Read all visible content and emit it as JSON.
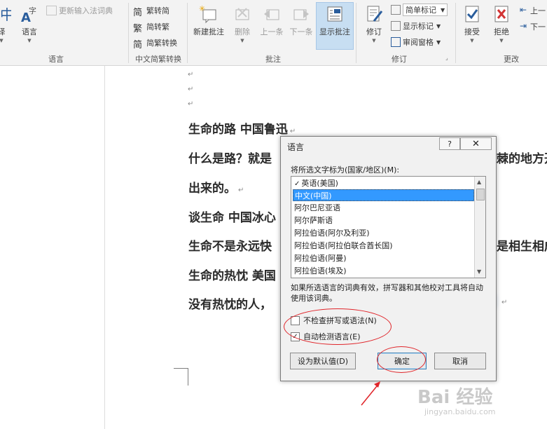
{
  "ribbon": {
    "groups": {
      "language": "语言",
      "chinese_conversion": "中文简繁转换",
      "comments": "批注",
      "tracking": "修订",
      "changes": "更改"
    },
    "translate_label": "译",
    "language_label": "语言",
    "update_ime_dict": "更新输入法词典",
    "trad_to_simp": "繁转简",
    "simp_to_trad": "简转繁",
    "simp_trad_convert": "简繁转换",
    "new_comment": "新建批注",
    "delete": "删除",
    "previous": "上一条",
    "next": "下一条",
    "show_comments": "显示批注",
    "track_changes": "修订",
    "simple_markup": "简单标记",
    "show_markup": "显示标记",
    "reviewing_pane": "审阅窗格",
    "accept": "接受",
    "reject": "拒绝",
    "prev_change": "上一",
    "next_change": "下一"
  },
  "document": {
    "lines": [
      "生命的路  中国鲁迅",
      "什么是路？就是",
      "出来的。",
      "谈生命  中国冰心",
      "生命不是永远快",
      "生命的热忱  美国",
      "没有热忱的人，"
    ],
    "line1_tail": "棘的地方开",
    "line4_tail": "是相生相成",
    "para_mark": "↵"
  },
  "dialog": {
    "title": "语言",
    "help_button": "?",
    "prompt": "将所选文字标为(国家/地区)(M):",
    "languages": [
      "英语(美国)",
      "中文(中国)",
      "阿尔巴尼亚语",
      "阿尔萨斯语",
      "阿拉伯语(阿尔及利亚)",
      "阿拉伯语(阿拉伯联合酋长国)",
      "阿拉伯语(阿曼)",
      "阿拉伯语(埃及)"
    ],
    "selected_index": 1,
    "note": "如果所选语言的词典有效，拼写器和其他校对工具将自动使用该词典。",
    "no_proofing": "不检查拼写或语法(N)",
    "no_proofing_checked": false,
    "detect_language": "自动检测语言(E)",
    "detect_language_checked": true,
    "set_default": "设为默认值(D)",
    "ok": "确定",
    "cancel": "取消"
  },
  "watermark": {
    "brand": "Bai 经验",
    "url": "jingyan.baidu.com"
  },
  "colors": {
    "accent_blue": "#3399ff",
    "annotation_red": "#e0252a",
    "selected_ribbon_btn": "#c7def2"
  }
}
